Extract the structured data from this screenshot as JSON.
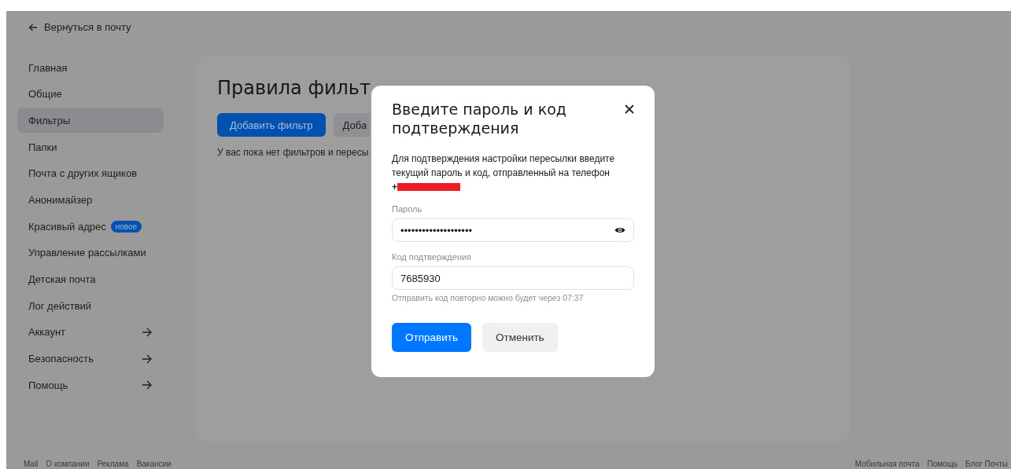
{
  "back_link": {
    "label": "Вернуться в почту"
  },
  "sidebar": {
    "items": [
      {
        "label": "Главная",
        "selected": false
      },
      {
        "label": "Общие",
        "selected": false
      },
      {
        "label": "Фильтры",
        "selected": true
      },
      {
        "label": "Папки",
        "selected": false
      },
      {
        "label": "Почта с других ящиков",
        "selected": false
      },
      {
        "label": "Анонимайзер",
        "selected": false
      },
      {
        "label": "Красивый адрес",
        "selected": false,
        "badge": "новое"
      },
      {
        "label": "Управление рассылками",
        "selected": false
      },
      {
        "label": "Детская почта",
        "selected": false
      },
      {
        "label": "Лог действий",
        "selected": false
      },
      {
        "label": "Аккаунт",
        "selected": false,
        "submenu": true
      },
      {
        "label": "Безопасность",
        "selected": false,
        "submenu": true
      },
      {
        "label": "Помощь",
        "selected": false,
        "submenu": true
      }
    ]
  },
  "content": {
    "title": "Правила фильт",
    "buttons": [
      {
        "label": "Добавить фильтр",
        "kind": "primary"
      },
      {
        "label": "Доба",
        "kind": "secondary"
      }
    ],
    "empty_text": "У вас пока нет фильтров и пересы"
  },
  "dialog": {
    "title": "Введите пароль и код подтверждения",
    "description": "Для подтверждения настройки пересылки введите текущий пароль и код, отправленный на телефон",
    "phone_prefix": "+",
    "phone_redacted": true,
    "fields": [
      {
        "label": "Пароль",
        "value": "••••••••••••••••••••",
        "kind": "password"
      },
      {
        "label": "Код подтверждения",
        "value": "7685930",
        "kind": "text",
        "hint": "Отправить код повторно можно будет через 07:37"
      }
    ],
    "buttons": [
      {
        "label": "Отправить",
        "kind": "primary"
      },
      {
        "label": "Отменить",
        "kind": "secondary"
      }
    ]
  },
  "footer": {
    "left_links": [
      "Mail",
      "О компании",
      "Реклама",
      "Вакансии"
    ],
    "right_links": [
      "Мобильная почта",
      "Помощь",
      "Блог Почты"
    ]
  }
}
